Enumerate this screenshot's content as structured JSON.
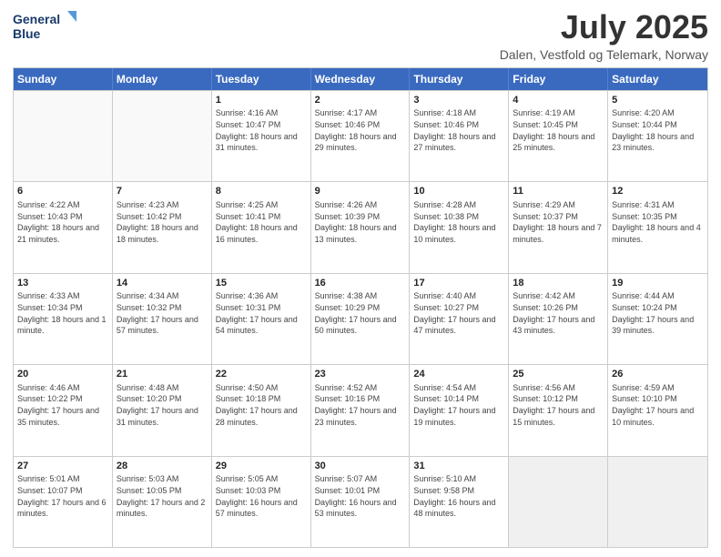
{
  "logo": {
    "line1": "General",
    "line2": "Blue"
  },
  "title": "July 2025",
  "subtitle": "Dalen, Vestfold og Telemark, Norway",
  "days": [
    "Sunday",
    "Monday",
    "Tuesday",
    "Wednesday",
    "Thursday",
    "Friday",
    "Saturday"
  ],
  "weeks": [
    [
      {
        "day": "",
        "text": ""
      },
      {
        "day": "",
        "text": ""
      },
      {
        "day": "1",
        "text": "Sunrise: 4:16 AM\nSunset: 10:47 PM\nDaylight: 18 hours and 31 minutes."
      },
      {
        "day": "2",
        "text": "Sunrise: 4:17 AM\nSunset: 10:46 PM\nDaylight: 18 hours and 29 minutes."
      },
      {
        "day": "3",
        "text": "Sunrise: 4:18 AM\nSunset: 10:46 PM\nDaylight: 18 hours and 27 minutes."
      },
      {
        "day": "4",
        "text": "Sunrise: 4:19 AM\nSunset: 10:45 PM\nDaylight: 18 hours and 25 minutes."
      },
      {
        "day": "5",
        "text": "Sunrise: 4:20 AM\nSunset: 10:44 PM\nDaylight: 18 hours and 23 minutes."
      }
    ],
    [
      {
        "day": "6",
        "text": "Sunrise: 4:22 AM\nSunset: 10:43 PM\nDaylight: 18 hours and 21 minutes."
      },
      {
        "day": "7",
        "text": "Sunrise: 4:23 AM\nSunset: 10:42 PM\nDaylight: 18 hours and 18 minutes."
      },
      {
        "day": "8",
        "text": "Sunrise: 4:25 AM\nSunset: 10:41 PM\nDaylight: 18 hours and 16 minutes."
      },
      {
        "day": "9",
        "text": "Sunrise: 4:26 AM\nSunset: 10:39 PM\nDaylight: 18 hours and 13 minutes."
      },
      {
        "day": "10",
        "text": "Sunrise: 4:28 AM\nSunset: 10:38 PM\nDaylight: 18 hours and 10 minutes."
      },
      {
        "day": "11",
        "text": "Sunrise: 4:29 AM\nSunset: 10:37 PM\nDaylight: 18 hours and 7 minutes."
      },
      {
        "day": "12",
        "text": "Sunrise: 4:31 AM\nSunset: 10:35 PM\nDaylight: 18 hours and 4 minutes."
      }
    ],
    [
      {
        "day": "13",
        "text": "Sunrise: 4:33 AM\nSunset: 10:34 PM\nDaylight: 18 hours and 1 minute."
      },
      {
        "day": "14",
        "text": "Sunrise: 4:34 AM\nSunset: 10:32 PM\nDaylight: 17 hours and 57 minutes."
      },
      {
        "day": "15",
        "text": "Sunrise: 4:36 AM\nSunset: 10:31 PM\nDaylight: 17 hours and 54 minutes."
      },
      {
        "day": "16",
        "text": "Sunrise: 4:38 AM\nSunset: 10:29 PM\nDaylight: 17 hours and 50 minutes."
      },
      {
        "day": "17",
        "text": "Sunrise: 4:40 AM\nSunset: 10:27 PM\nDaylight: 17 hours and 47 minutes."
      },
      {
        "day": "18",
        "text": "Sunrise: 4:42 AM\nSunset: 10:26 PM\nDaylight: 17 hours and 43 minutes."
      },
      {
        "day": "19",
        "text": "Sunrise: 4:44 AM\nSunset: 10:24 PM\nDaylight: 17 hours and 39 minutes."
      }
    ],
    [
      {
        "day": "20",
        "text": "Sunrise: 4:46 AM\nSunset: 10:22 PM\nDaylight: 17 hours and 35 minutes."
      },
      {
        "day": "21",
        "text": "Sunrise: 4:48 AM\nSunset: 10:20 PM\nDaylight: 17 hours and 31 minutes."
      },
      {
        "day": "22",
        "text": "Sunrise: 4:50 AM\nSunset: 10:18 PM\nDaylight: 17 hours and 28 minutes."
      },
      {
        "day": "23",
        "text": "Sunrise: 4:52 AM\nSunset: 10:16 PM\nDaylight: 17 hours and 23 minutes."
      },
      {
        "day": "24",
        "text": "Sunrise: 4:54 AM\nSunset: 10:14 PM\nDaylight: 17 hours and 19 minutes."
      },
      {
        "day": "25",
        "text": "Sunrise: 4:56 AM\nSunset: 10:12 PM\nDaylight: 17 hours and 15 minutes."
      },
      {
        "day": "26",
        "text": "Sunrise: 4:59 AM\nSunset: 10:10 PM\nDaylight: 17 hours and 10 minutes."
      }
    ],
    [
      {
        "day": "27",
        "text": "Sunrise: 5:01 AM\nSunset: 10:07 PM\nDaylight: 17 hours and 6 minutes."
      },
      {
        "day": "28",
        "text": "Sunrise: 5:03 AM\nSunset: 10:05 PM\nDaylight: 17 hours and 2 minutes."
      },
      {
        "day": "29",
        "text": "Sunrise: 5:05 AM\nSunset: 10:03 PM\nDaylight: 16 hours and 57 minutes."
      },
      {
        "day": "30",
        "text": "Sunrise: 5:07 AM\nSunset: 10:01 PM\nDaylight: 16 hours and 53 minutes."
      },
      {
        "day": "31",
        "text": "Sunrise: 5:10 AM\nSunset: 9:58 PM\nDaylight: 16 hours and 48 minutes."
      },
      {
        "day": "",
        "text": ""
      },
      {
        "day": "",
        "text": ""
      }
    ]
  ]
}
